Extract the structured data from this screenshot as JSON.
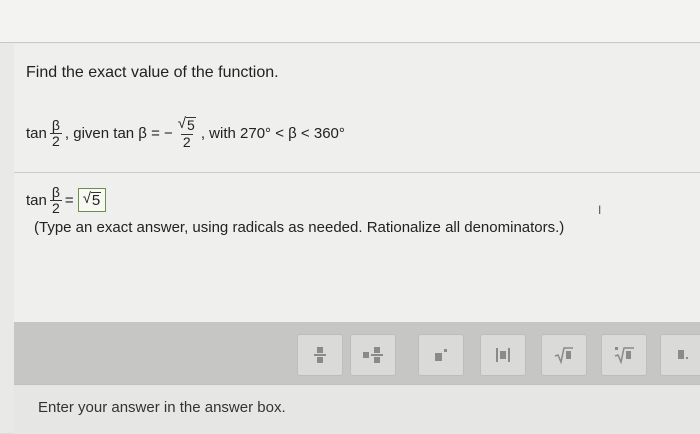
{
  "prompt": "Find the exact value of the function.",
  "question": {
    "fn": "tan",
    "half_num": "β",
    "half_den": "2",
    "given_text": ", given tan β = −",
    "given_num_radicand": "5",
    "given_den": "2",
    "with_text": ", with 270° < β < 360°"
  },
  "answer": {
    "fn": "tan",
    "half_num": "β",
    "half_den": "2",
    "equals": "=",
    "value_radicand": "5"
  },
  "hint": "(Type an exact answer, using radicals as needed. Rationalize all denominators.)",
  "toolbar": {
    "tools": [
      {
        "name": "fraction-tool"
      },
      {
        "name": "mixed-number-tool"
      },
      {
        "name": "exponent-tool"
      },
      {
        "name": "absolute-value-tool"
      },
      {
        "name": "square-root-tool"
      },
      {
        "name": "nth-root-tool"
      },
      {
        "name": "decimal-tool"
      }
    ]
  },
  "status": "Enter your answer in the answer box."
}
